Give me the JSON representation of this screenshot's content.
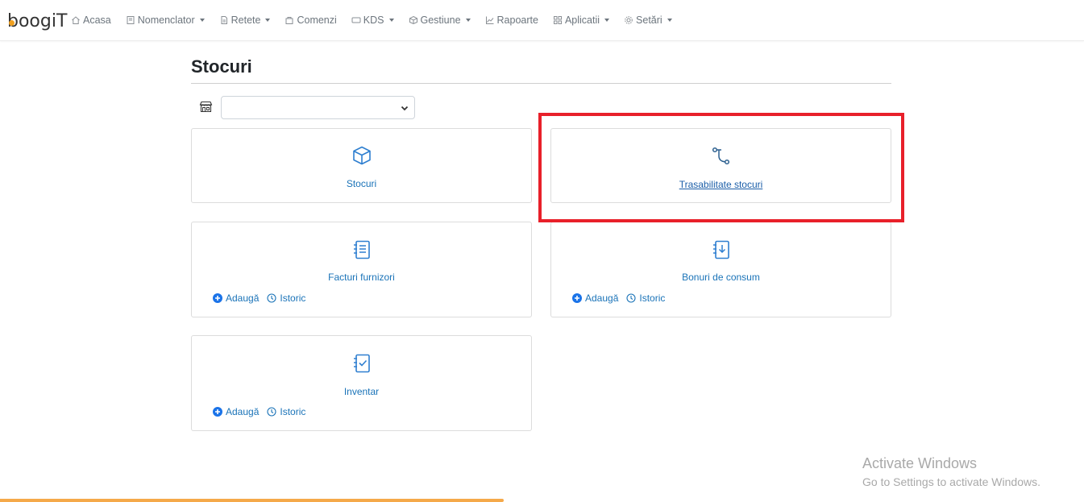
{
  "brand": {
    "logo_text": "boogiT",
    "dot_color": "#f0a020"
  },
  "nav": {
    "items": [
      {
        "label": "Acasa",
        "icon": "home-icon",
        "dropdown": false
      },
      {
        "label": "Nomenclator",
        "icon": "book-icon",
        "dropdown": true
      },
      {
        "label": "Retete",
        "icon": "recipe-icon",
        "dropdown": true
      },
      {
        "label": "Comenzi",
        "icon": "bag-icon",
        "dropdown": false
      },
      {
        "label": "KDS",
        "icon": "display-icon",
        "dropdown": true
      },
      {
        "label": "Gestiune",
        "icon": "box-icon",
        "dropdown": true
      },
      {
        "label": "Rapoarte",
        "icon": "chart-icon",
        "dropdown": false
      },
      {
        "label": "Aplicatii",
        "icon": "grid-icon",
        "dropdown": true
      },
      {
        "label": "Setări",
        "icon": "gear-icon",
        "dropdown": true
      }
    ]
  },
  "page": {
    "title": "Stocuri",
    "store_select_value": ""
  },
  "cards": {
    "stocuri": {
      "label": "Stocuri",
      "icon": "cube-icon"
    },
    "trasabilitate": {
      "label": "Trasabilitate stocuri",
      "icon": "trace-icon"
    },
    "facturi": {
      "label": "Facturi furnizori",
      "icon": "invoice-icon",
      "add": "Adaugă",
      "history": "Istoric"
    },
    "bonuri": {
      "label": "Bonuri de consum",
      "icon": "consume-icon",
      "add": "Adaugă",
      "history": "Istoric"
    },
    "inventar": {
      "label": "Inventar",
      "icon": "inventory-icon",
      "add": "Adaugă",
      "history": "Istoric"
    }
  },
  "watermark": {
    "title": "Activate Windows",
    "subtitle": "Go to Settings to activate Windows."
  },
  "colors": {
    "link": "#1a73b8",
    "icon": "#2f7fd0",
    "highlight": "#e8202a",
    "progress": "#f5a94a"
  }
}
